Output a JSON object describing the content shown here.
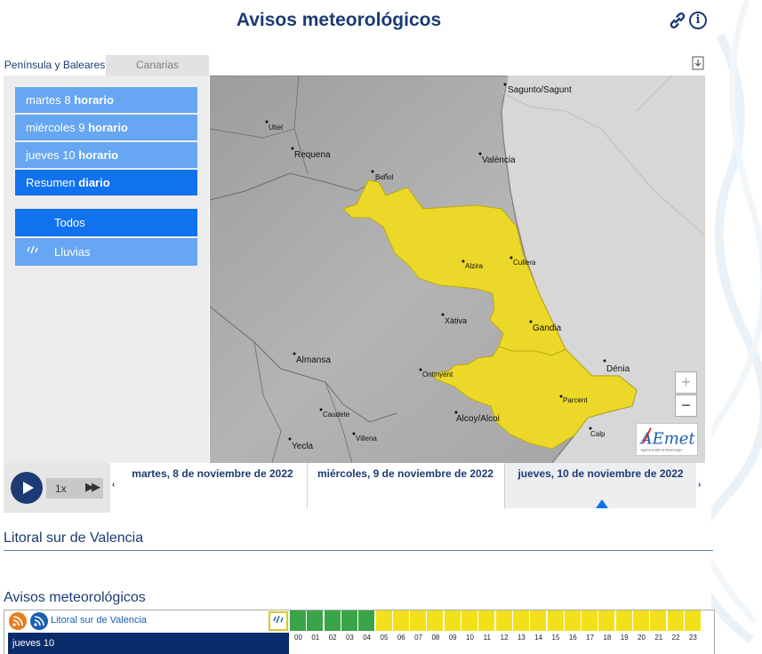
{
  "header": {
    "title": "Avisos meteorológicos"
  },
  "region_tabs": [
    {
      "label": "Península y Baleares"
    },
    {
      "label": "Canarias"
    }
  ],
  "days": [
    {
      "prefix": "martes 8",
      "suffix": "horario"
    },
    {
      "prefix": "miércoles 9",
      "suffix": "horario"
    },
    {
      "prefix": "jueves 10",
      "suffix": "horario"
    },
    {
      "prefix": "Resumen",
      "suffix": "diario"
    }
  ],
  "phenomena": [
    {
      "label": "Todos"
    },
    {
      "label": "Lluvias"
    }
  ],
  "map": {
    "places": [
      "Sagunto/Sagunt",
      "Utiel",
      "Requena",
      "València",
      "Buñol",
      "Alzira",
      "Cullera",
      "Xàtiva",
      "Gandia",
      "Almansa",
      "Ontinyent",
      "Dénia",
      "Parcent",
      "Caudete",
      "Alcoy/Alcoi",
      "Calp",
      "Yecla",
      "Villena"
    ],
    "warning_color": "#ebd829",
    "zoom_in": "+",
    "zoom_out": "−",
    "logo": "AEmet",
    "logo_subtitle": "Agencia Estatal de Meteorología"
  },
  "player": {
    "speed": "1x"
  },
  "timeline": {
    "days": [
      "martes, 8 de noviembre de 2022",
      "miércoles, 9 de noviembre de 2022",
      "jueves, 10 de noviembre de 2022"
    ],
    "selected_index": 2
  },
  "zone": {
    "title": "Litoral sur de Valencia"
  },
  "avisos": {
    "title": "Avisos meteorológicos",
    "zone_link": "Litoral sur de Valencia",
    "day_label": "jueves 10",
    "hours": [
      "00",
      "01",
      "02",
      "03",
      "04",
      "05",
      "06",
      "07",
      "08",
      "09",
      "10",
      "11",
      "12",
      "13",
      "14",
      "15",
      "16",
      "17",
      "18",
      "19",
      "20",
      "21",
      "22",
      "23"
    ],
    "levels": [
      "green",
      "green",
      "green",
      "green",
      "green",
      "yellow",
      "yellow",
      "yellow",
      "yellow",
      "yellow",
      "yellow",
      "yellow",
      "yellow",
      "yellow",
      "yellow",
      "yellow",
      "yellow",
      "yellow",
      "yellow",
      "yellow",
      "yellow",
      "yellow",
      "yellow",
      "yellow"
    ],
    "colors": {
      "green": "#3aa548",
      "yellow": "#f2e11a"
    }
  }
}
